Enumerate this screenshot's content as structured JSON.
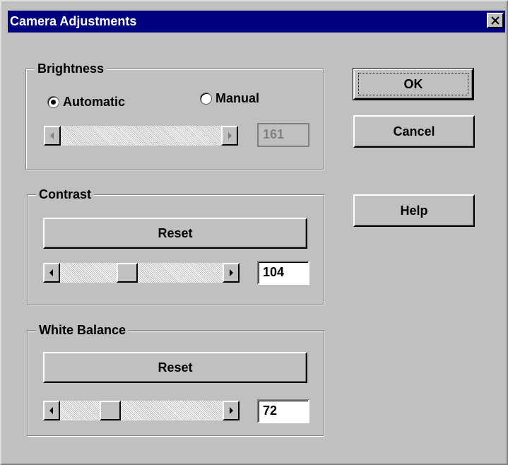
{
  "window": {
    "title": "Camera Adjustments"
  },
  "brightness": {
    "group_label": "Brightness",
    "automatic_label": "Automatic",
    "manual_label": "Manual",
    "mode_selected": "Automatic",
    "value": "161",
    "enabled": false
  },
  "contrast": {
    "group_label": "Contrast",
    "reset_label": "Reset",
    "value": "104"
  },
  "white_balance": {
    "group_label": "White Balance",
    "reset_label": "Reset",
    "value": "72"
  },
  "buttons": {
    "ok": "OK",
    "cancel": "Cancel",
    "help": "Help"
  },
  "icons": {
    "close": "close-icon",
    "arrow_left": "scroll-left-arrow-icon",
    "arrow_right": "scroll-right-arrow-icon"
  },
  "colors": {
    "titlebar": "#000080",
    "face": "#c0c0c0"
  }
}
